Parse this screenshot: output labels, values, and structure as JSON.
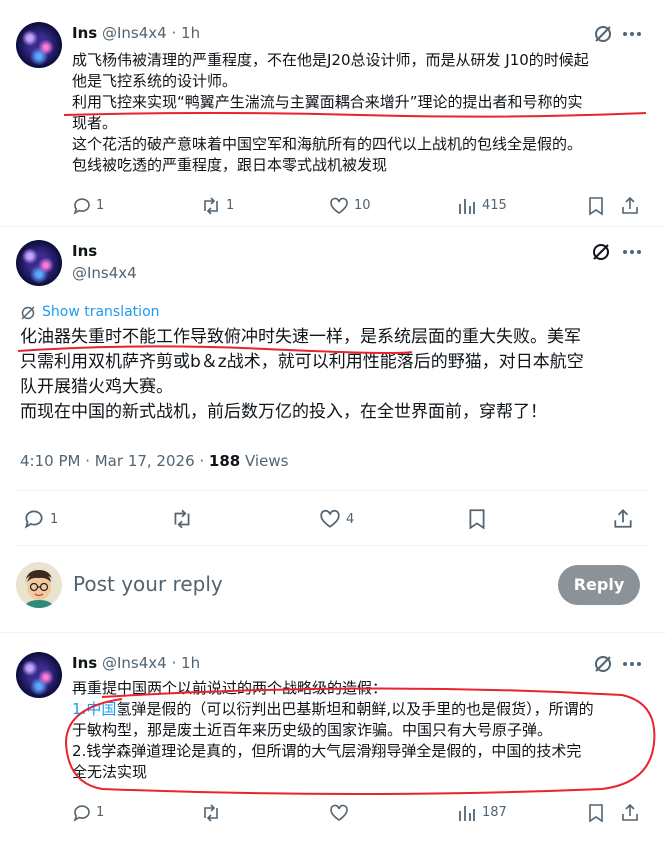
{
  "tweet1": {
    "name": "Ins",
    "handle": "@Ins4x4",
    "time": "1h",
    "lines": [
      "成飞杨伟被清理的严重程度，不在他是J20总设计师，而是从研发 J10的时候起",
      "他是飞控系统的设计师。",
      "利用飞控来实现“鸭翼产生湍流与主翼面耦合来增升”理论的提出者和号称的实",
      "现者。",
      "这个花活的破产意味着中国空军和海航所有的四代以上战机的包线全是假的。",
      "包线被吃透的严重程度，跟日本零式战机被发现"
    ],
    "replies": "1",
    "reposts": "1",
    "likes": "10",
    "views": "415"
  },
  "tweet2": {
    "name": "Ins",
    "handle": "@Ins4x4",
    "show_translation": "Show translation",
    "lines": [
      "化油器失重时不能工作导致俯冲时失速一样，是系统层面的重大失败。美军",
      "只需利用双机萨齐剪或b＆z战术，就可以利用性能落后的野猫，对日本航空",
      "队开展猎火鸡大赛。",
      "而现在中国的新式战机，前后数万亿的投入，在全世界面前，穿帮了！"
    ],
    "timestamp": "4:10 PM · Mar 17, 2026 · ",
    "views_count": "188",
    "views_label": " Views",
    "replies": "1",
    "likes": "4"
  },
  "compose": {
    "placeholder": "Post your reply",
    "button": "Reply"
  },
  "tweet3": {
    "name": "Ins",
    "handle": "@Ins4x4",
    "time": "1h",
    "line1": "再重提中国两个以前说过的两个战略级的造假：",
    "line2_prefix": "1.",
    "line2_link": "中国",
    "line2_rest": "氢弹是假的（可以衍判出巴基斯坦和朝鲜,以及手里的也是假货），所谓的",
    "line3": "于敏构型，那是废土近百年来历史级的国家诈骗。中国只有大号原子弹。",
    "line4": "2.钱学森弹道理论是真的，但所谓的大气层滑翔导弹全是假的，中国的技术完",
    "line5": "全无法实现",
    "replies": "1",
    "views": "187"
  },
  "colors": {
    "accent": "#1d9bf0",
    "annotation": "#e8242f",
    "reply_button": "#8b9298"
  }
}
